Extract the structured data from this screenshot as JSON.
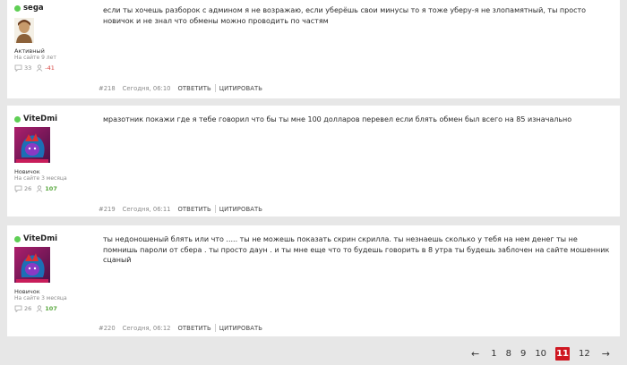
{
  "posts": [
    {
      "username": "sega",
      "rank": "Активный",
      "since": "На сайте 9 лет",
      "messages": "33",
      "reputation": "-41",
      "text": "если ты хочешь разборок с админом я не возражаю, если уберёшь свои минусы то я тоже уберу-я не злопамятный, ты просто новичок и не знал что обмены можно проводить по частям",
      "number": "#218",
      "time": "Сегодня, 06:10",
      "reply_label": "ОТВЕТИТЬ",
      "quote_label": "ЦИТИРОВАТЬ"
    },
    {
      "username": "ViteDmi",
      "rank": "Новичок",
      "since": "На сайте 3 месяца",
      "messages": "26",
      "reputation": "107",
      "text": "мразотник покажи где я тебе говорил что бы ты мне 100 долларов  перевел если блять обмен был всего на 85 изначально",
      "number": "#219",
      "time": "Сегодня, 06:11",
      "reply_label": "ОТВЕТИТЬ",
      "quote_label": "ЦИТИРОВАТЬ"
    },
    {
      "username": "ViteDmi",
      "rank": "Новичок",
      "since": "На сайте 3 месяца",
      "messages": "26",
      "reputation": "107",
      "text": "ты недоношеный блять или что .....  ты не можешь показать скрин скрилла. ты незнаешь сколько у тебя на нем денег ты не помнишь пароли от сбера . ты просто даун . и ты мне еще что то будешь говорить   в 8 утра ты будешь заблочен на сайте мошенник сцаный",
      "number": "#220",
      "time": "Сегодня, 06:12",
      "reply_label": "ОТВЕТИТЬ",
      "quote_label": "ЦИТИРОВАТЬ"
    }
  ],
  "pagination": {
    "prev": "←",
    "next": "→",
    "pages": [
      "1",
      "8",
      "9",
      "10",
      "11",
      "12"
    ],
    "current": "11"
  },
  "colors": {
    "online": "#5fcf55",
    "active_page": "#cf1721",
    "rep_negative": "#d6403c",
    "rep_positive": "#58a83d"
  }
}
